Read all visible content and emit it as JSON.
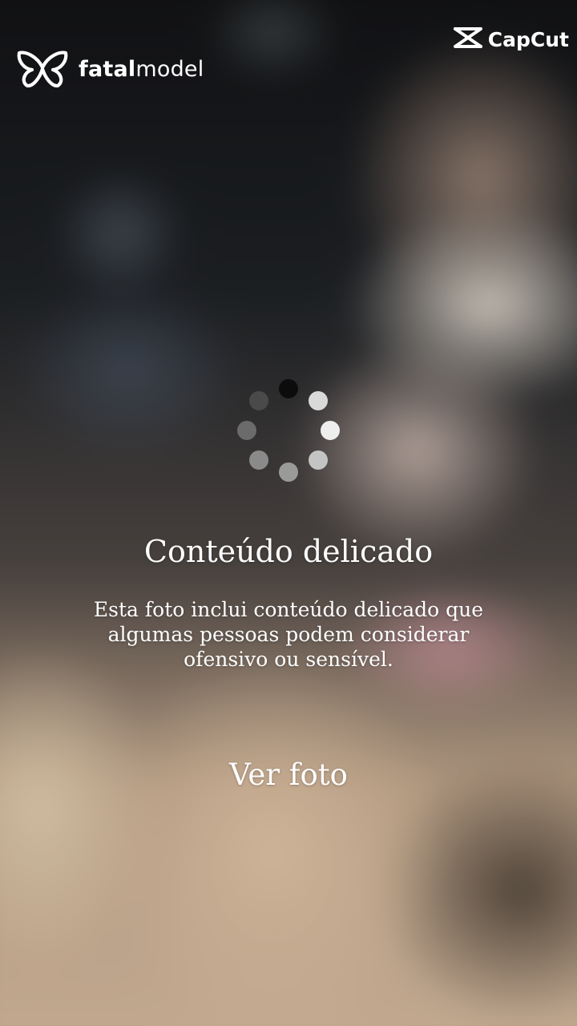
{
  "brand": {
    "name_bold": "fatal",
    "name_regular": "model"
  },
  "watermark": {
    "label": "CapCut"
  },
  "spinner": {
    "icon": "loading-spinner-icon",
    "dot_colors": [
      "#0c0c0c",
      "#d9d9d9",
      "#eeeeee",
      "#c4c4c4",
      "#9a9a9a",
      "#8a8a8a",
      "#6b6b6b",
      "#4a4a4a"
    ]
  },
  "notice": {
    "title": "Conteúdo delicado",
    "description": "Esta foto inclui conteúdo delicado que algumas pessoas podem considerar ofensivo ou sensível.",
    "view_button": "Ver foto"
  },
  "colors": {
    "text": "#ffffff"
  }
}
